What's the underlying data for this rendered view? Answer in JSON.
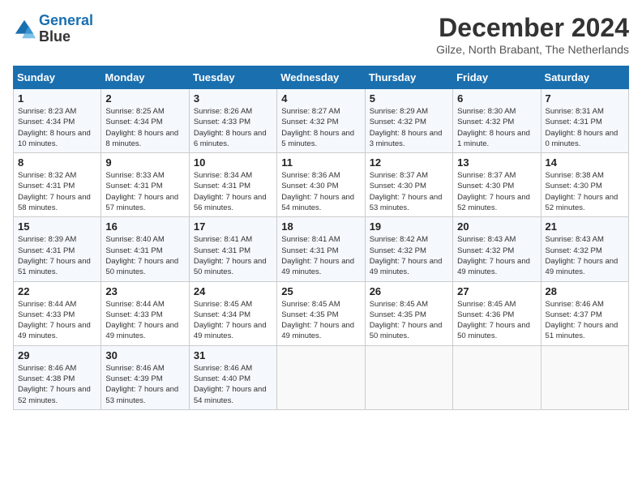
{
  "logo": {
    "line1": "General",
    "line2": "Blue"
  },
  "title": "December 2024",
  "subtitle": "Gilze, North Brabant, The Netherlands",
  "days_header": [
    "Sunday",
    "Monday",
    "Tuesday",
    "Wednesday",
    "Thursday",
    "Friday",
    "Saturday"
  ],
  "weeks": [
    [
      {
        "day": "1",
        "sunrise": "8:23 AM",
        "sunset": "4:34 PM",
        "daylight": "8 hours and 10 minutes."
      },
      {
        "day": "2",
        "sunrise": "8:25 AM",
        "sunset": "4:34 PM",
        "daylight": "8 hours and 8 minutes."
      },
      {
        "day": "3",
        "sunrise": "8:26 AM",
        "sunset": "4:33 PM",
        "daylight": "8 hours and 6 minutes."
      },
      {
        "day": "4",
        "sunrise": "8:27 AM",
        "sunset": "4:32 PM",
        "daylight": "8 hours and 5 minutes."
      },
      {
        "day": "5",
        "sunrise": "8:29 AM",
        "sunset": "4:32 PM",
        "daylight": "8 hours and 3 minutes."
      },
      {
        "day": "6",
        "sunrise": "8:30 AM",
        "sunset": "4:32 PM",
        "daylight": "8 hours and 1 minute."
      },
      {
        "day": "7",
        "sunrise": "8:31 AM",
        "sunset": "4:31 PM",
        "daylight": "8 hours and 0 minutes."
      }
    ],
    [
      {
        "day": "8",
        "sunrise": "8:32 AM",
        "sunset": "4:31 PM",
        "daylight": "7 hours and 58 minutes."
      },
      {
        "day": "9",
        "sunrise": "8:33 AM",
        "sunset": "4:31 PM",
        "daylight": "7 hours and 57 minutes."
      },
      {
        "day": "10",
        "sunrise": "8:34 AM",
        "sunset": "4:31 PM",
        "daylight": "7 hours and 56 minutes."
      },
      {
        "day": "11",
        "sunrise": "8:36 AM",
        "sunset": "4:30 PM",
        "daylight": "7 hours and 54 minutes."
      },
      {
        "day": "12",
        "sunrise": "8:37 AM",
        "sunset": "4:30 PM",
        "daylight": "7 hours and 53 minutes."
      },
      {
        "day": "13",
        "sunrise": "8:37 AM",
        "sunset": "4:30 PM",
        "daylight": "7 hours and 52 minutes."
      },
      {
        "day": "14",
        "sunrise": "8:38 AM",
        "sunset": "4:30 PM",
        "daylight": "7 hours and 52 minutes."
      }
    ],
    [
      {
        "day": "15",
        "sunrise": "8:39 AM",
        "sunset": "4:31 PM",
        "daylight": "7 hours and 51 minutes."
      },
      {
        "day": "16",
        "sunrise": "8:40 AM",
        "sunset": "4:31 PM",
        "daylight": "7 hours and 50 minutes."
      },
      {
        "day": "17",
        "sunrise": "8:41 AM",
        "sunset": "4:31 PM",
        "daylight": "7 hours and 50 minutes."
      },
      {
        "day": "18",
        "sunrise": "8:41 AM",
        "sunset": "4:31 PM",
        "daylight": "7 hours and 49 minutes."
      },
      {
        "day": "19",
        "sunrise": "8:42 AM",
        "sunset": "4:32 PM",
        "daylight": "7 hours and 49 minutes."
      },
      {
        "day": "20",
        "sunrise": "8:43 AM",
        "sunset": "4:32 PM",
        "daylight": "7 hours and 49 minutes."
      },
      {
        "day": "21",
        "sunrise": "8:43 AM",
        "sunset": "4:32 PM",
        "daylight": "7 hours and 49 minutes."
      }
    ],
    [
      {
        "day": "22",
        "sunrise": "8:44 AM",
        "sunset": "4:33 PM",
        "daylight": "7 hours and 49 minutes."
      },
      {
        "day": "23",
        "sunrise": "8:44 AM",
        "sunset": "4:33 PM",
        "daylight": "7 hours and 49 minutes."
      },
      {
        "day": "24",
        "sunrise": "8:45 AM",
        "sunset": "4:34 PM",
        "daylight": "7 hours and 49 minutes."
      },
      {
        "day": "25",
        "sunrise": "8:45 AM",
        "sunset": "4:35 PM",
        "daylight": "7 hours and 49 minutes."
      },
      {
        "day": "26",
        "sunrise": "8:45 AM",
        "sunset": "4:35 PM",
        "daylight": "7 hours and 50 minutes."
      },
      {
        "day": "27",
        "sunrise": "8:45 AM",
        "sunset": "4:36 PM",
        "daylight": "7 hours and 50 minutes."
      },
      {
        "day": "28",
        "sunrise": "8:46 AM",
        "sunset": "4:37 PM",
        "daylight": "7 hours and 51 minutes."
      }
    ],
    [
      {
        "day": "29",
        "sunrise": "8:46 AM",
        "sunset": "4:38 PM",
        "daylight": "7 hours and 52 minutes."
      },
      {
        "day": "30",
        "sunrise": "8:46 AM",
        "sunset": "4:39 PM",
        "daylight": "7 hours and 53 minutes."
      },
      {
        "day": "31",
        "sunrise": "8:46 AM",
        "sunset": "4:40 PM",
        "daylight": "7 hours and 54 minutes."
      },
      null,
      null,
      null,
      null
    ]
  ]
}
